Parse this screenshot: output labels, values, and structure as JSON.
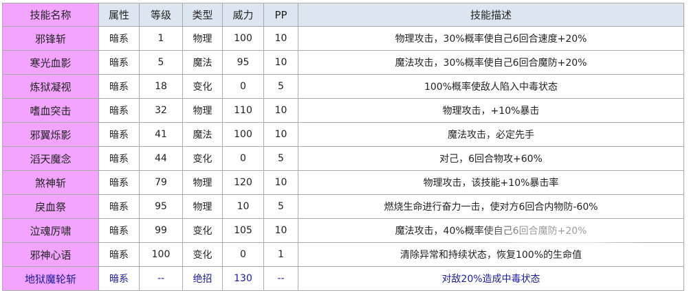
{
  "table": {
    "headers": [
      "技能名称",
      "属性",
      "等级",
      "类型",
      "威力",
      "PP",
      "技能描述"
    ],
    "rows": [
      {
        "name": "邪锋斩",
        "attr": "暗系",
        "level": "1",
        "type": "物理",
        "power": "100",
        "pp": "10",
        "desc": "物理攻击，30%概率使自己6回合速度+20%"
      },
      {
        "name": "寒光血影",
        "attr": "暗系",
        "level": "5",
        "type": "魔法",
        "power": "95",
        "pp": "10",
        "desc": "魔法攻击，30%概率使自己6回合魔防+20%"
      },
      {
        "name": "炼狱凝视",
        "attr": "暗系",
        "level": "18",
        "type": "变化",
        "power": "0",
        "pp": "5",
        "desc": "100%概率使敌人陷入中毒状态"
      },
      {
        "name": "嗜血突击",
        "attr": "暗系",
        "level": "32",
        "type": "物理",
        "power": "110",
        "pp": "10",
        "desc": "物理攻击，+10%暴击"
      },
      {
        "name": "邪翼烁影",
        "attr": "暗系",
        "level": "41",
        "type": "魔法",
        "power": "100",
        "pp": "10",
        "desc": "魔法攻击，必定先手"
      },
      {
        "name": "滔天魔念",
        "attr": "暗系",
        "level": "44",
        "type": "变化",
        "power": "0",
        "pp": "5",
        "desc": "对己，6回合物攻+60%"
      },
      {
        "name": "煞神斩",
        "attr": "暗系",
        "level": "79",
        "type": "物理",
        "power": "120",
        "pp": "10",
        "desc": "物理攻击，该技能+10%暴击率"
      },
      {
        "name": "戾血祭",
        "attr": "暗系",
        "level": "95",
        "type": "物理",
        "power": "10",
        "pp": "5",
        "desc": "燃烧生命进行奋力一击，使对方6回合内物防-60%"
      },
      {
        "name": "泣魂厉啸",
        "attr": "暗系",
        "level": "99",
        "type": "变化",
        "power": "105",
        "pp": "10",
        "desc": "魔法攻击，40%概率使自己6回合魔防+20%"
      },
      {
        "name": "邪神心语",
        "attr": "暗系",
        "level": "100",
        "type": "变化",
        "power": "0",
        "pp": "1",
        "desc": "清除异常和持续状态，恢复100%的生命值"
      },
      {
        "name": "地狱魔轮斩",
        "attr": "暗系",
        "level": "--",
        "type": "绝招",
        "power": "130",
        "pp": "--",
        "desc": "对敌20%造成中毒状态"
      }
    ]
  },
  "colors": {
    "name_cell_bg": "#f3a4ff",
    "header_bg": "#dde6f0",
    "border": "#a9a9a9",
    "ultimate_text": "#1a1a9a"
  }
}
